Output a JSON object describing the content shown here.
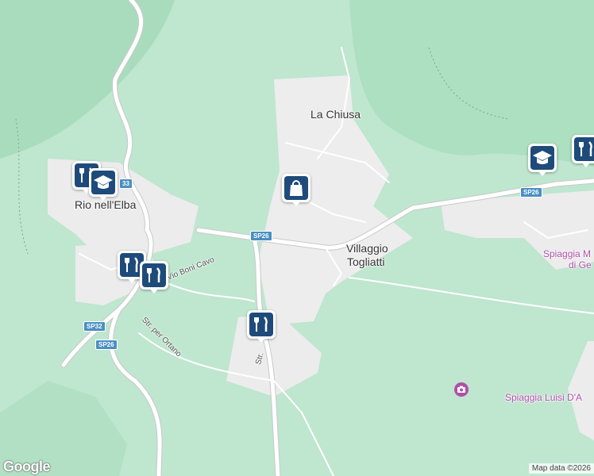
{
  "map": {
    "places": {
      "la_chiusa": "La Chiusa",
      "rio_nell_elba": "Rio nell'Elba",
      "villaggio_line1": "Villaggio",
      "villaggio_line2": "Togliatti",
      "spiaggia_luisi": "Spiaggia Luisi D'A",
      "spiaggia_partial_line1": "Spiaggia M",
      "spiaggia_partial_line2": "di Ge"
    },
    "streets": {
      "boni_cavo": "Via Vio Boni Cavo",
      "ortano": "Str. per Ortano",
      "str_partial": "Str."
    },
    "road_shields": {
      "sp26_center": "SP26",
      "sp26_east": "SP26",
      "sp26_southwest": "SP26",
      "sp32": "SP32",
      "sp33": "33"
    },
    "markers": [
      {
        "icon": "restaurant-icon",
        "label": "Restaurant"
      },
      {
        "icon": "school-icon",
        "label": "School"
      },
      {
        "icon": "shopping-bag-icon",
        "label": "Shop"
      },
      {
        "icon": "restaurant-icon",
        "label": "Restaurant"
      },
      {
        "icon": "restaurant-icon",
        "label": "Restaurant"
      },
      {
        "icon": "restaurant-icon",
        "label": "Restaurant"
      },
      {
        "icon": "school-icon",
        "label": "School"
      },
      {
        "icon": "restaurant-icon",
        "label": "Restaurant"
      }
    ],
    "colors": {
      "land": "#bfe6cf",
      "urban": "#eeeeee",
      "road": "#ffffff",
      "marker": "#1e4b7a",
      "shield": "#4a8fc2",
      "poi_text": "#b04fa8"
    }
  },
  "branding": {
    "logo": "Google",
    "attribution": "Map data ©2026"
  }
}
